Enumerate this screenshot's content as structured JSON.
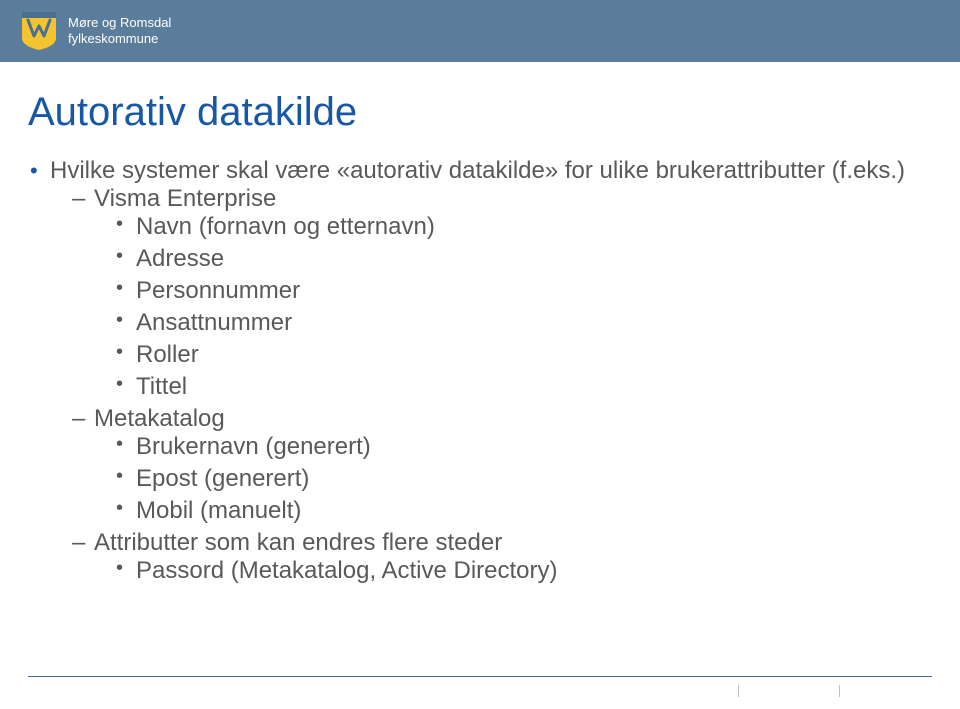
{
  "header": {
    "org_name_line1": "Møre og Romsdal",
    "org_name_line2": "fylkeskommune"
  },
  "title": "Autorativ datakilde",
  "l1": [
    {
      "text": "Hvilke systemer skal være «autorativ datakilde» for ulike brukerattributter (f.eks.)"
    }
  ],
  "l2": [
    {
      "text": "Visma Enterprise",
      "l3": [
        "Navn (fornavn og etternavn)",
        "Adresse",
        "Personnummer",
        "Ansattnummer",
        "Roller",
        "Tittel"
      ]
    },
    {
      "text": "Metakatalog",
      "l3": [
        "Brukernavn (generert)",
        "Epost (generert)",
        "Mobil (manuelt)"
      ]
    },
    {
      "text": "Attributter som kan endres flere steder",
      "l3": [
        "Passord (Metakatalog, Active Directory)"
      ]
    }
  ]
}
